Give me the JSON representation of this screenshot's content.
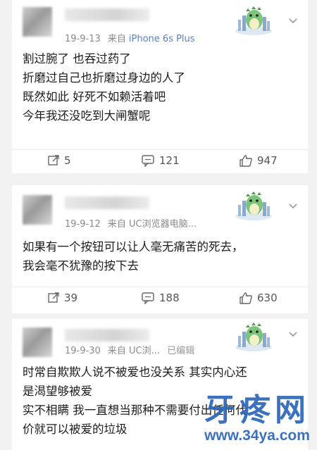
{
  "comments": [
    {
      "date": "19-9-13",
      "source_prefix": "来自",
      "device": "iPhone 6s Plus",
      "edited": "",
      "lines": [
        "割过腕了 也吞过药了",
        "折磨过自己也折磨过身边的人了",
        "既然如此 好死不如赖活着吧",
        "今年我还没吃到大闸蟹呢"
      ],
      "reposts": "5",
      "comments": "121",
      "likes": "947"
    },
    {
      "date": "19-9-12",
      "source_prefix": "来自",
      "device": "UC浏览器电脑...",
      "edited": "",
      "lines": [
        "如果有一个按钮可以让人毫无痛苦的死去，",
        "我会毫不犹豫的按下去"
      ],
      "reposts": "39",
      "comments": "188",
      "likes": "630"
    },
    {
      "date": "19-9-30",
      "source_prefix": "来自",
      "device": "UC浏...",
      "edited": "已编辑",
      "lines": [
        "时常自欺欺人说不被爱也没关系 其实内心还",
        "是渴望够被爱",
        "实不相瞒 我一直想当那种不需要付出任何代",
        "价就可以被爱的垃圾"
      ]
    }
  ],
  "icons": {
    "repost": "repost-icon",
    "comment": "comment-icon",
    "like": "thumbs-up-icon",
    "menu": "chevron-down-icon",
    "sticker": "dinosaur-sticker"
  },
  "watermark": {
    "title": "牙疼网",
    "url": "www.34ya.com"
  },
  "colors": {
    "device_link": "#5b7fbf",
    "watermark": "#2c66b8",
    "sticker_green": "#7cc47a"
  }
}
